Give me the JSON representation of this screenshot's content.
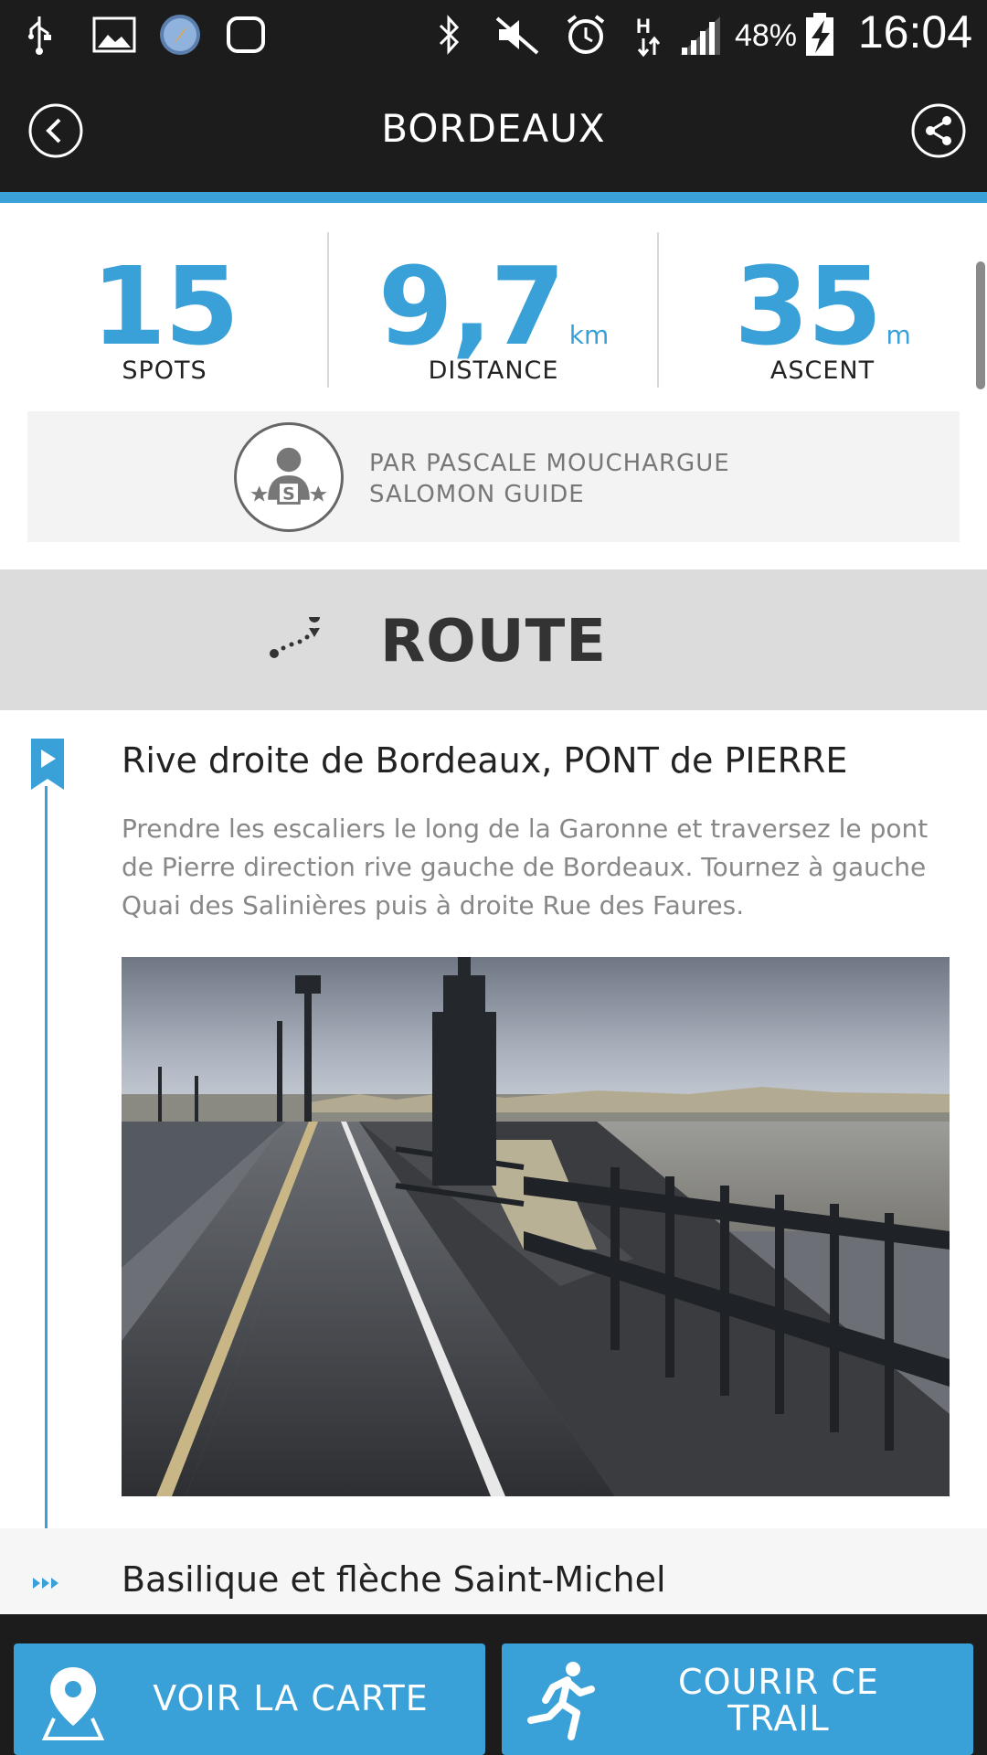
{
  "status_bar": {
    "battery_percent": "48%",
    "time": "16:04",
    "icons": [
      "usb-icon",
      "gallery-icon",
      "compass-app-icon",
      "watch-icon",
      "bluetooth-icon",
      "mute-icon",
      "alarm-icon",
      "network-h-icon",
      "signal-icon",
      "battery-charging-icon"
    ]
  },
  "header": {
    "title": "BORDEAUX",
    "back_icon": "back-chevron-icon",
    "share_icon": "share-icon"
  },
  "stats": {
    "spots": {
      "value": "15",
      "unit": "",
      "label": "SPOTS"
    },
    "distance": {
      "value": "9,7",
      "unit": "km",
      "label": "DISTANCE"
    },
    "ascent": {
      "value": "35",
      "unit": "m",
      "label": "ASCENT"
    }
  },
  "author": {
    "line1": "PAR PASCALE MOUCHARGUE",
    "line2": "SALOMON GUIDE",
    "avatar_icon": "salomon-guide-badge-icon"
  },
  "route": {
    "title": "ROUTE",
    "icon": "route-path-icon"
  },
  "steps": [
    {
      "title": "Rive droite de Bordeaux, PONT de PIERRE",
      "description": "Prendre les escaliers le long de la Garonne et traversez le pont de Pierre direction rive gauche de Bordeaux. Tournez à gauche Quai des Salinières puis à droite Rue des Faures.",
      "icon": "start-flag-icon"
    },
    {
      "title": "Basilique et flèche Saint-Michel",
      "icon": "waypoint-icon"
    }
  ],
  "actions": {
    "map_label": "VOIR LA CARTE",
    "run_label_line1": "COURIR CE",
    "run_label_line2": "TRAIL"
  },
  "colors": {
    "accent": "#3aa0d8",
    "bar": "#1c1c1c",
    "route_band": "#dcdcdc"
  }
}
